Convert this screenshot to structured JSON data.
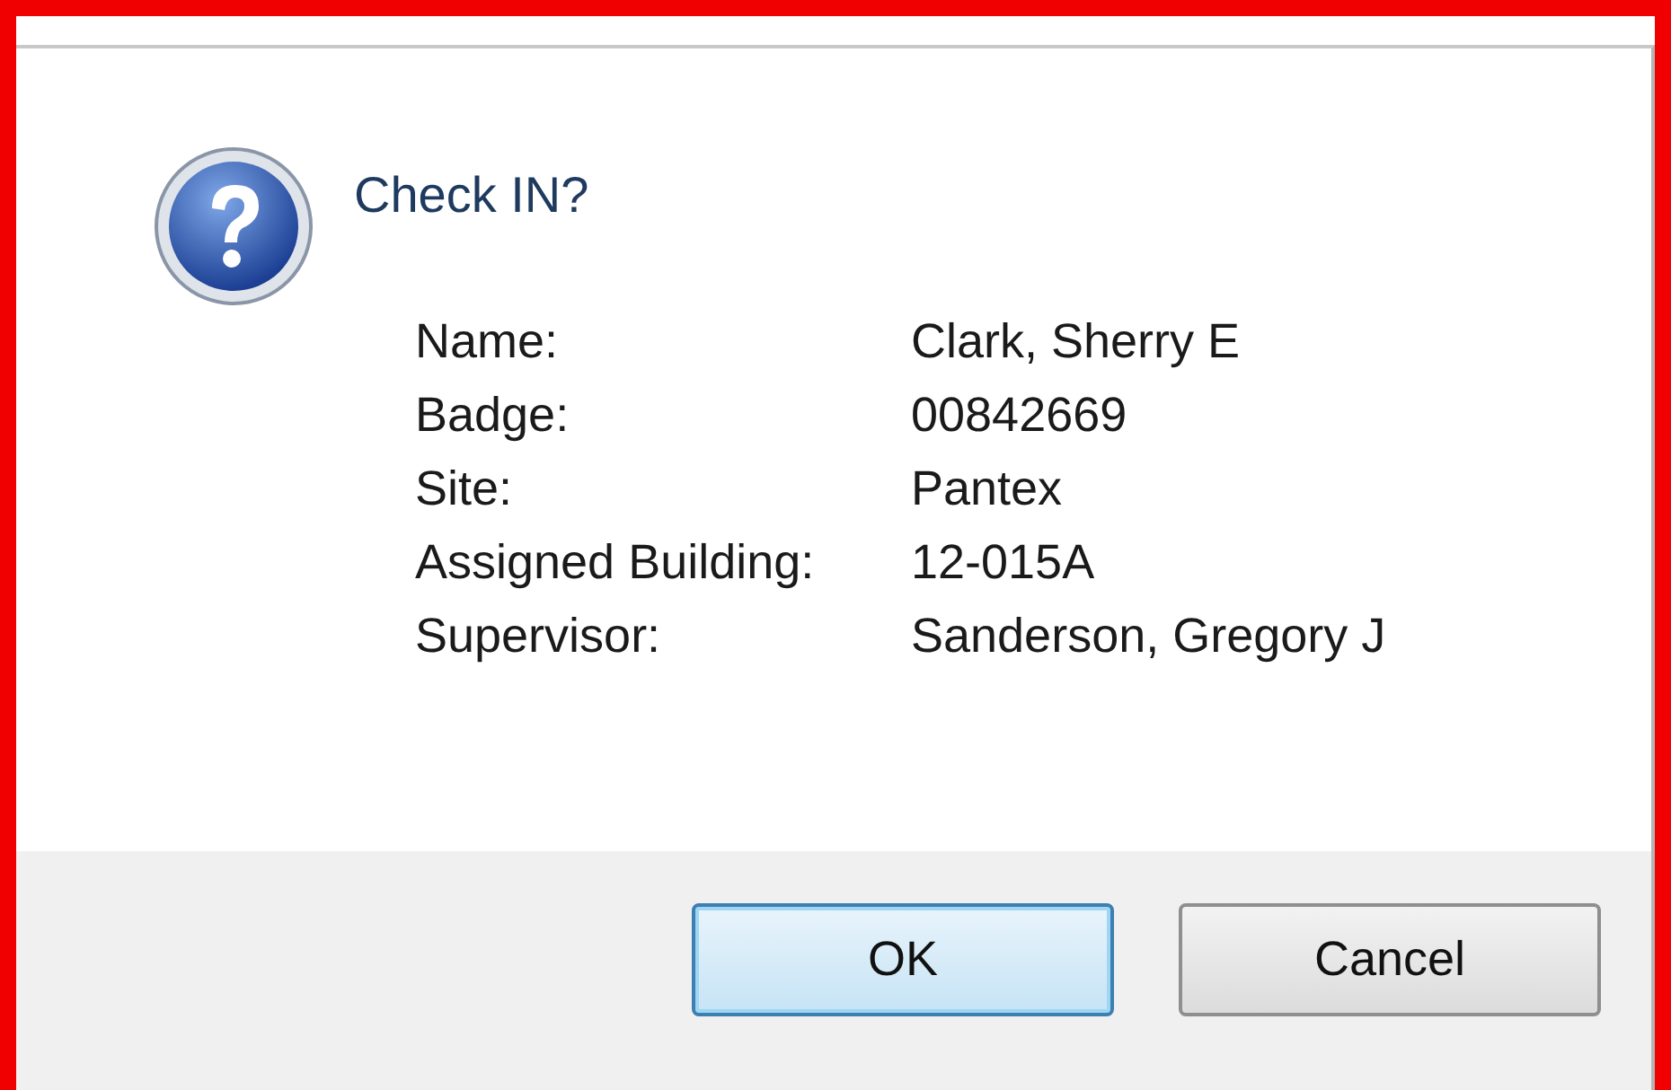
{
  "message": "Check IN?",
  "fields": [
    {
      "label": "Name:",
      "value": "Clark, Sherry E"
    },
    {
      "label": "Badge:",
      "value": "00842669"
    },
    {
      "label": "Site:",
      "value": "Pantex"
    },
    {
      "label": "Assigned Building:",
      "value": "12-015A"
    },
    {
      "label": "Supervisor:",
      "value": "Sanderson, Gregory J"
    }
  ],
  "buttons": [
    {
      "label": "OK",
      "default": true
    },
    {
      "label": "Cancel",
      "default": false
    }
  ]
}
